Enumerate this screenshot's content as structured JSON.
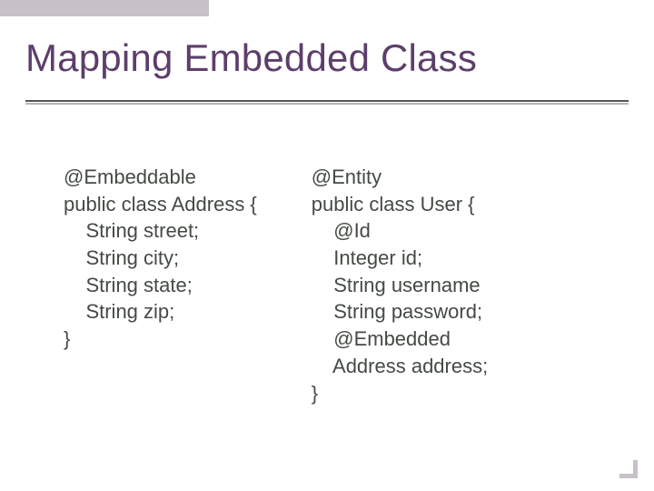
{
  "title": "Mapping Embedded Class",
  "code": {
    "left": "@Embeddable\npublic class Address {\n    String street;\n    String city;\n    String state;\n    String zip;\n}",
    "right": "@Entity\npublic class User {\n    @Id\n    Integer id;\n    String username\n    String password;\n    @Embedded\n    Address address;\n}"
  }
}
